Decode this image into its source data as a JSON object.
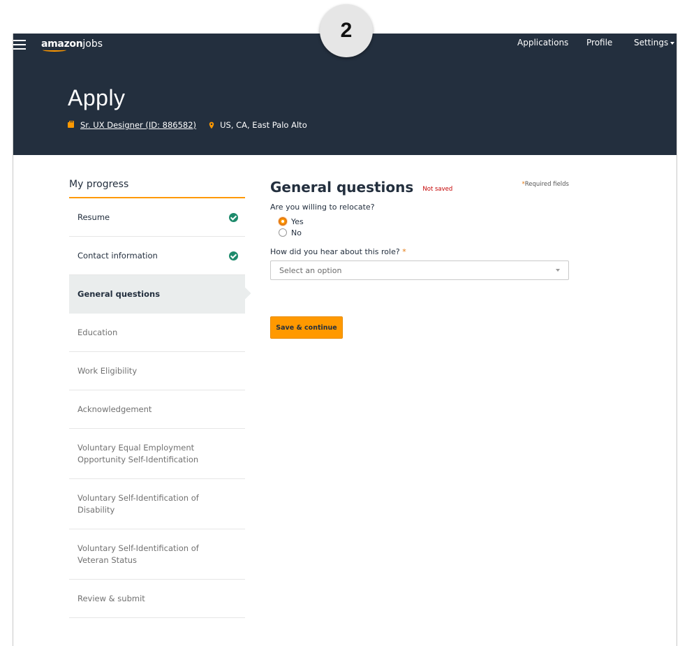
{
  "nav": {
    "logo_brand": "amazon",
    "logo_suffix": "jobs",
    "links": [
      "Applications",
      "Profile",
      "Settings"
    ]
  },
  "badge": "2",
  "hero": {
    "title": "Apply",
    "job_link": "Sr. UX Designer (ID: 886582)",
    "location": "US, CA, East Palo Alto"
  },
  "sidebar": {
    "title": "My progress",
    "steps": [
      {
        "label": "Resume",
        "status": "complete"
      },
      {
        "label": "Contact information",
        "status": "complete"
      },
      {
        "label": "General questions",
        "status": "active"
      },
      {
        "label": "Education",
        "status": "pending"
      },
      {
        "label": "Work Eligibility",
        "status": "pending"
      },
      {
        "label": "Acknowledgement",
        "status": "pending"
      },
      {
        "label": "Voluntary Equal Employment Opportunity Self-Identification",
        "status": "pending"
      },
      {
        "label": "Voluntary Self-Identification of Disability",
        "status": "pending"
      },
      {
        "label": "Voluntary Self-Identification of Veteran Status",
        "status": "pending"
      },
      {
        "label": "Review & submit",
        "status": "pending"
      }
    ]
  },
  "form": {
    "title": "General questions",
    "status": "Not saved",
    "required_star": "*",
    "required_note": "Required fields",
    "q1": "Are you willing to relocate?",
    "q1_options": [
      "Yes",
      "No"
    ],
    "q1_selected": "Yes",
    "q2": "How did you hear about this role?",
    "q2_placeholder": "Select an option",
    "save_label": "Save & continue"
  },
  "colors": {
    "nav_bg": "#232f3e",
    "accent": "#ff9900",
    "success": "#1d8a6b",
    "error": "#c40000"
  }
}
